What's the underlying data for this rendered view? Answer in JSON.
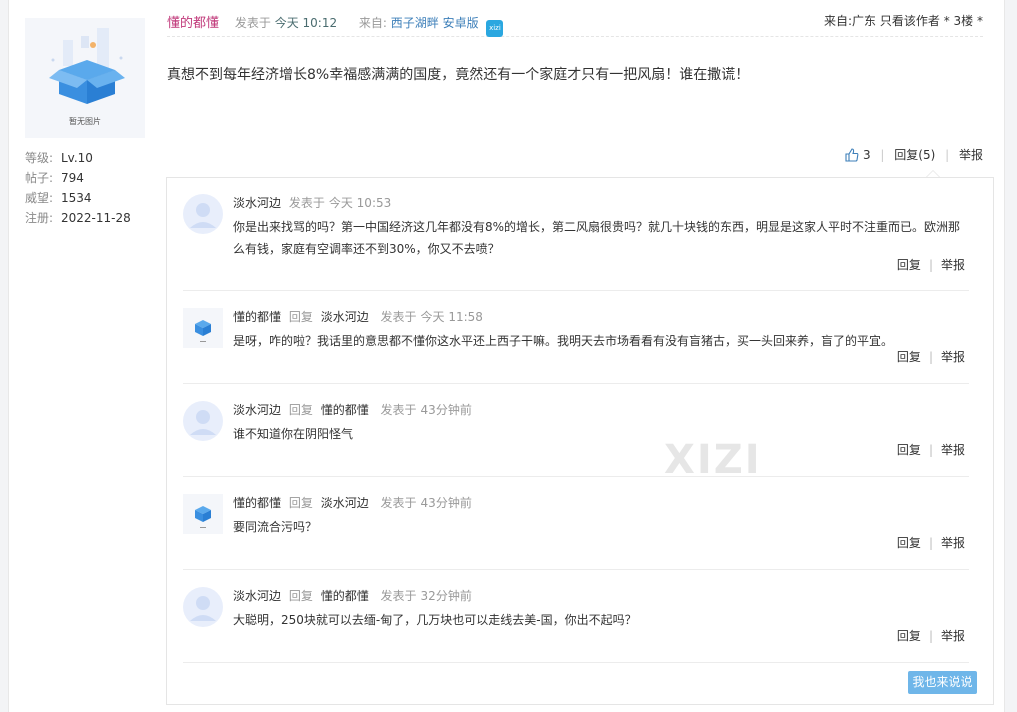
{
  "sidebar": {
    "avatar_caption": "暂无图片",
    "stats": [
      {
        "key": "等级:",
        "value": "Lv.10"
      },
      {
        "key": "帖子:",
        "value": "794"
      },
      {
        "key": "威望:",
        "value": "1534"
      },
      {
        "key": "注册:",
        "value": "2022-11-28"
      }
    ]
  },
  "post": {
    "author": "懂的都懂",
    "posted_label": "发表于",
    "posted_time": "今天 10:12",
    "from_label": "来自:",
    "from_source": "西子湖畔 安卓版",
    "app_badge": "xizi",
    "location": "来自:广东",
    "author_only": "只看该作者",
    "floor": "* 3楼 *",
    "content": "真想不到每年经济增长8%幸福感满满的国度，竟然还有一个家庭才只有一把风扇！谁在撒谎！",
    "like_count": "3",
    "reply_label": "回复(5)",
    "report_label": "举报"
  },
  "replies": [
    {
      "name": "淡水河边",
      "reply_word": "",
      "reply_to": "",
      "time_label": "发表于",
      "time": "今天 10:53",
      "content": "你是出来找骂的吗？第一中国经济这几年都没有8%的增长，第二风扇很贵吗？就几十块钱的东西，明显是这家人平时不注重而已。欧洲那么有钱，家庭有空调率还不到30%，你又不去喷？",
      "reply_btn": "回复",
      "report_btn": "举报"
    },
    {
      "name": "懂的都懂",
      "reply_word": "回复",
      "reply_to": "淡水河边",
      "time_label": "发表于",
      "time": "今天 11:58",
      "content": "是呀，咋的啦？我话里的意思都不懂你这水平还上西子干嘛。我明天去市场看看有没有盲猪古，买一头回来养，盲了的平宜。",
      "reply_btn": "回复",
      "report_btn": "举报"
    },
    {
      "name": "淡水河边",
      "reply_word": "回复",
      "reply_to": "懂的都懂",
      "time_label": "发表于",
      "time": "43分钟前",
      "content": "谁不知道你在阴阳怪气",
      "reply_btn": "回复",
      "report_btn": "举报"
    },
    {
      "name": "懂的都懂",
      "reply_word": "回复",
      "reply_to": "淡水河边",
      "time_label": "发表于",
      "time": "43分钟前",
      "content": "要同流合污吗？",
      "reply_btn": "回复",
      "report_btn": "举报"
    },
    {
      "name": "淡水河边",
      "reply_word": "回复",
      "reply_to": "懂的都懂",
      "time_label": "发表于",
      "time": "32分钟前",
      "content": "大聪明，250块就可以去缅-甸了，几万块也可以走线去美-国，你出不起吗？",
      "reply_btn": "回复",
      "report_btn": "举报"
    }
  ],
  "say_button": "我也来说说",
  "watermark": "XIZI"
}
